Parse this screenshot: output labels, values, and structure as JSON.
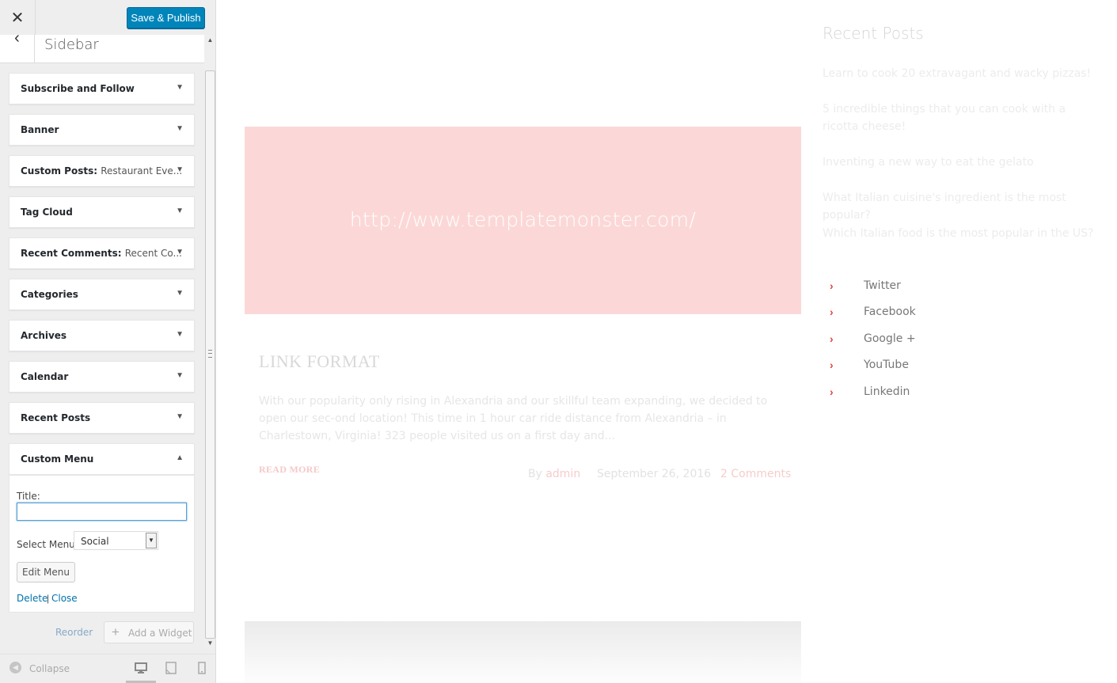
{
  "topbar": {
    "close_icon": "close-icon",
    "save_label": "Save & Publish"
  },
  "section": {
    "back_icon": "chevron-left-icon",
    "title": "Sidebar"
  },
  "widgets": [
    {
      "title": "Subscribe and Follow",
      "subtitle": ""
    },
    {
      "title": "Banner",
      "subtitle": ""
    },
    {
      "title": "Custom Posts:",
      "subtitle": "Restaurant Eve..."
    },
    {
      "title": "Tag Cloud",
      "subtitle": ""
    },
    {
      "title": "Recent Comments:",
      "subtitle": "Recent Co..."
    },
    {
      "title": "Categories",
      "subtitle": ""
    },
    {
      "title": "Archives",
      "subtitle": ""
    },
    {
      "title": "Calendar",
      "subtitle": ""
    },
    {
      "title": "Recent Posts",
      "subtitle": ""
    },
    {
      "title": "Custom Menu",
      "subtitle": ""
    }
  ],
  "custom_menu_form": {
    "title_label": "Title:",
    "title_value": "",
    "select_label": "Select Menu:",
    "select_value": "Social",
    "edit_menu_label": "Edit Menu",
    "delete_label": "Delete",
    "separator": "|",
    "close_label": "Close"
  },
  "panel_actions": {
    "reorder_label": "Reorder",
    "add_widget_label": "Add a Widget"
  },
  "footer": {
    "collapse_label": "Collapse",
    "devices": [
      "desktop-icon",
      "tablet-icon",
      "mobile-icon"
    ],
    "active_device": "desktop"
  },
  "preview": {
    "banner_url": "http://www.templatemonster.com/",
    "post": {
      "title": "LINK FORMAT",
      "excerpt": "With our popularity only rising in Alexandria and our skillful team expanding, we decided to open our sec-ond location! This time in 1 hour car ride distance from Alexandria – in Charlestown, Virginia! 323 people visited us on a first day and...",
      "read_more": "READ MORE",
      "by_label": "By",
      "author": "admin",
      "date": "September 26, 2016",
      "comments": "2 Comments"
    },
    "recent_posts": {
      "title": "Recent Posts",
      "items": [
        "Learn to cook 20 extravagant and wacky pizzas!",
        "5 incredible things that you can cook with a ricotta cheese!",
        "Inventing a new way to eat the gelato",
        "What Italian cuisine's ingredient is the most popular?",
        "Which Italian food is the most popular in the US?"
      ]
    },
    "social": [
      "Twitter",
      "Facebook",
      "Google +",
      "YouTube",
      "Linkedin"
    ]
  },
  "colors": {
    "primary_button": "#0085ba",
    "link": "#0073aa",
    "accent_red": "#e2433e",
    "banner": "#fbd8d7"
  }
}
